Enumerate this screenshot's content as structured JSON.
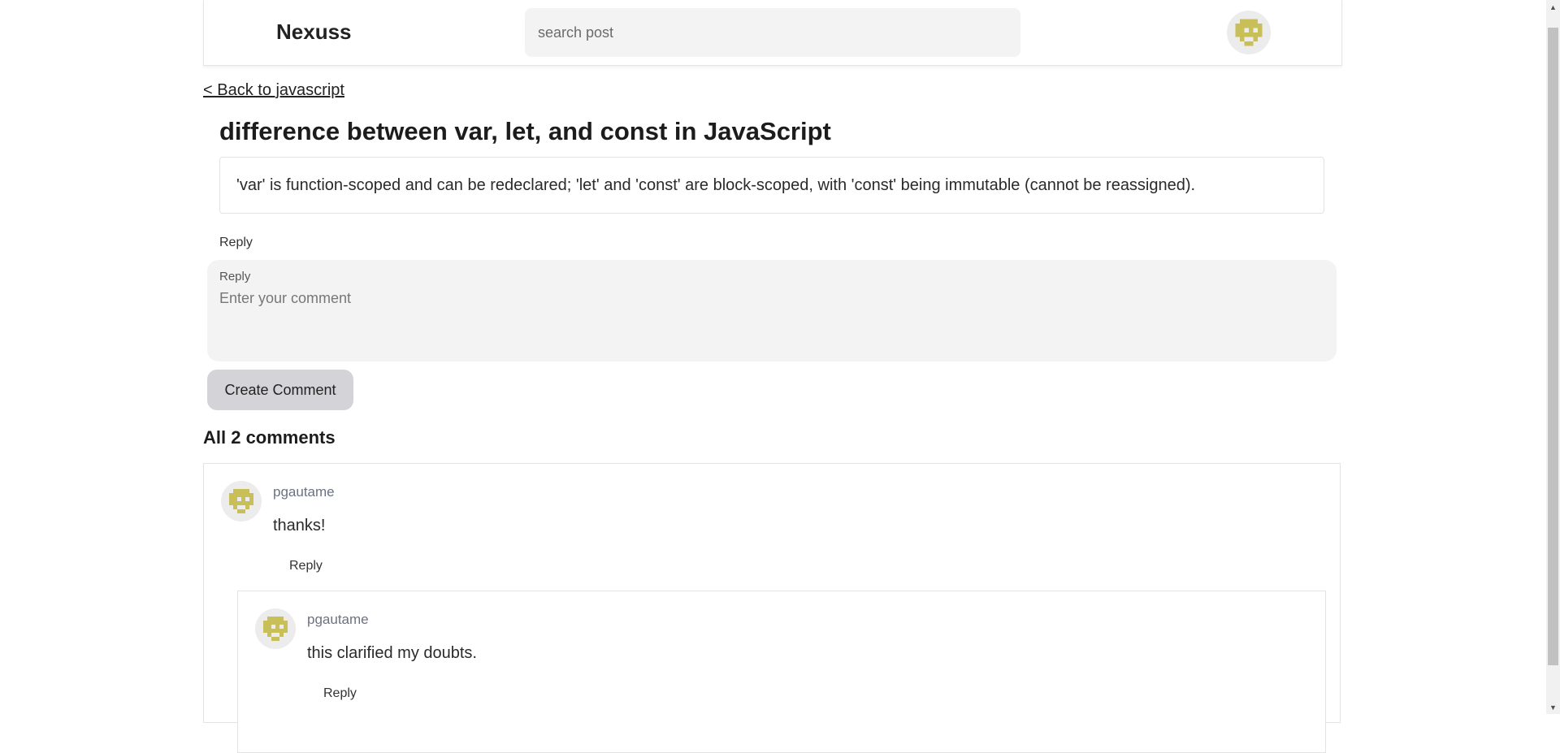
{
  "header": {
    "logo": "Nexuss",
    "search_placeholder": "search post",
    "avatar_icon": "pixel-avatar-icon"
  },
  "back_link": "< Back to javascript",
  "post": {
    "title": "difference between var, let, and const in JavaScript",
    "body": "'var' is function-scoped and can be redeclared; 'let' and 'const' are block-scoped, with 'const' being immutable (cannot be reassigned)."
  },
  "reply_link": "Reply",
  "comment_form": {
    "label": "Reply",
    "placeholder": "Enter your comment",
    "submit_label": "Create Comment"
  },
  "comments_heading": "All 2 comments",
  "comments": [
    {
      "author": "pgautame",
      "text": "thanks!",
      "reply_label": "Reply",
      "replies": [
        {
          "author": "pgautame",
          "text": "this clarified my doubts.",
          "reply_label": "Reply"
        }
      ]
    }
  ],
  "colors": {
    "avatar_fg": "#c8bf58",
    "avatar_bg": "#ececec",
    "button_bg": "#d4d4d8",
    "input_bg": "#f3f3f3"
  }
}
